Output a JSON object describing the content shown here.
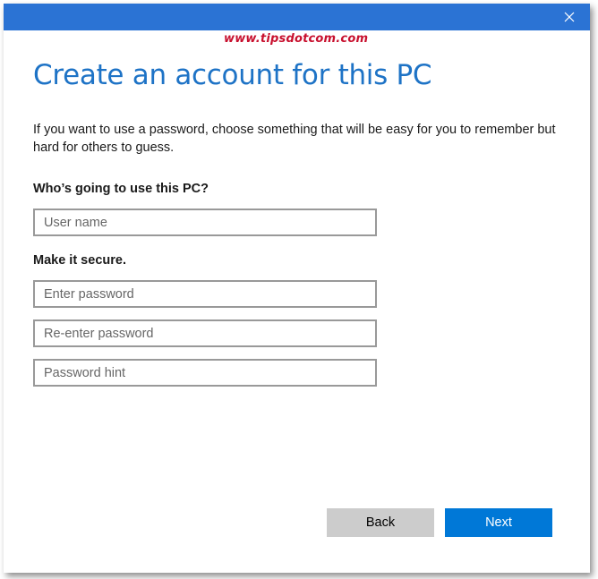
{
  "titlebar": {
    "close_icon": "close-icon",
    "accent_color": "#2b73d4"
  },
  "watermark": "www.tipsdotcom.com",
  "page": {
    "title": "Create an account for this PC",
    "intro": "If you want to use a password, choose something that will be easy for you to remember but hard for others to guess."
  },
  "user_section": {
    "label": "Who’s going to use this PC?",
    "username_placeholder": "User name",
    "username_value": ""
  },
  "secure_section": {
    "label": "Make it secure.",
    "password_placeholder": "Enter password",
    "reenter_placeholder": "Re-enter password",
    "hint_placeholder": "Password hint"
  },
  "buttons": {
    "back_label": "Back",
    "next_label": "Next",
    "next_color": "#0078d7"
  }
}
